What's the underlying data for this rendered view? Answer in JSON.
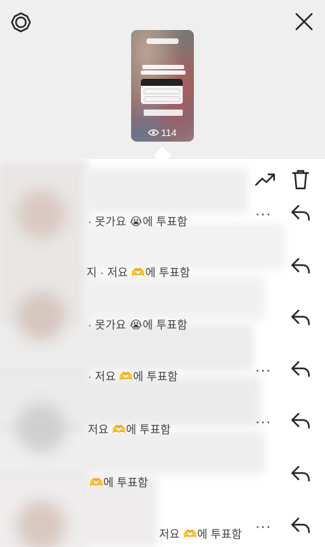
{
  "header": {
    "settings_icon": "gear-icon",
    "close_icon": "close-icon",
    "story": {
      "view_count": "114",
      "eye_icon": "eye-icon"
    }
  },
  "toolbar": {
    "insights_icon": "trending-up-icon",
    "delete_icon": "trash-icon"
  },
  "votes": [
    {
      "text": "· 못가요 😭에 투표함",
      "show_more": true
    },
    {
      "text": "지 · 저요 🫶에 투표함",
      "show_more": false
    },
    {
      "text": "· 못가요 😭에 투표함",
      "show_more": false
    },
    {
      "text": "· 저요 🫶에 투표함",
      "show_more": true
    },
    {
      "text": "저요 🫶에 투표함",
      "show_more": true
    },
    {
      "text": "🫶에 투표함",
      "show_more": false
    },
    {
      "text": "저요 🫶에 투표함",
      "show_more": true
    }
  ],
  "more_label": "···",
  "colors": {
    "panel_bg": "#efefef",
    "text": "#262626",
    "muted_text": "#444444"
  }
}
